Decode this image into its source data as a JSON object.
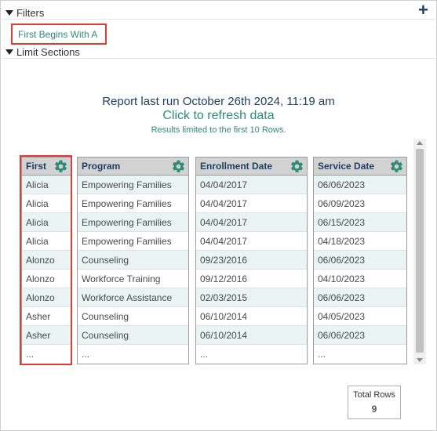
{
  "filters": {
    "label": "Filters",
    "add_icon": "plus-icon"
  },
  "filter_item": {
    "label": "First Begins With A"
  },
  "limit_sections": {
    "label": "Limit Sections"
  },
  "report": {
    "last_run": "Report last run October 26th 2024, 11:19 am",
    "refresh": "Click to refresh data",
    "limited": "Results limited to the first 10 Rows."
  },
  "columns": [
    {
      "header": "First",
      "values": [
        "Alicia",
        "Alicia",
        "Alicia",
        "Alicia",
        "Alonzo",
        "Alonzo",
        "Alonzo",
        "Asher",
        "Asher",
        "..."
      ]
    },
    {
      "header": "Program",
      "values": [
        "Empowering Families",
        "Empowering Families",
        "Empowering Families",
        "Empowering Families",
        "Counseling",
        "Workforce Training",
        "Workforce Assistance",
        "Counseling",
        "Counseling",
        "..."
      ]
    },
    {
      "header": "Enrollment Date",
      "values": [
        "04/04/2017",
        "04/04/2017",
        "04/04/2017",
        "04/04/2017",
        "09/23/2016",
        "09/12/2016",
        "02/03/2015",
        "06/10/2014",
        "06/10/2014",
        "..."
      ]
    },
    {
      "header": "Service Date",
      "values": [
        "06/06/2023",
        "06/09/2023",
        "06/15/2023",
        "04/18/2023",
        "06/06/2023",
        "04/10/2023",
        "06/06/2023",
        "04/05/2023",
        "06/06/2023",
        "..."
      ]
    }
  ],
  "totals": {
    "label": "Total Rows",
    "value": "9"
  },
  "colors": {
    "accent": "#2e8b78",
    "navy": "#1f3f66",
    "highlight": "#e53935",
    "row_alt": "#eaf4f4",
    "header_bg": "#d2d2d2"
  }
}
